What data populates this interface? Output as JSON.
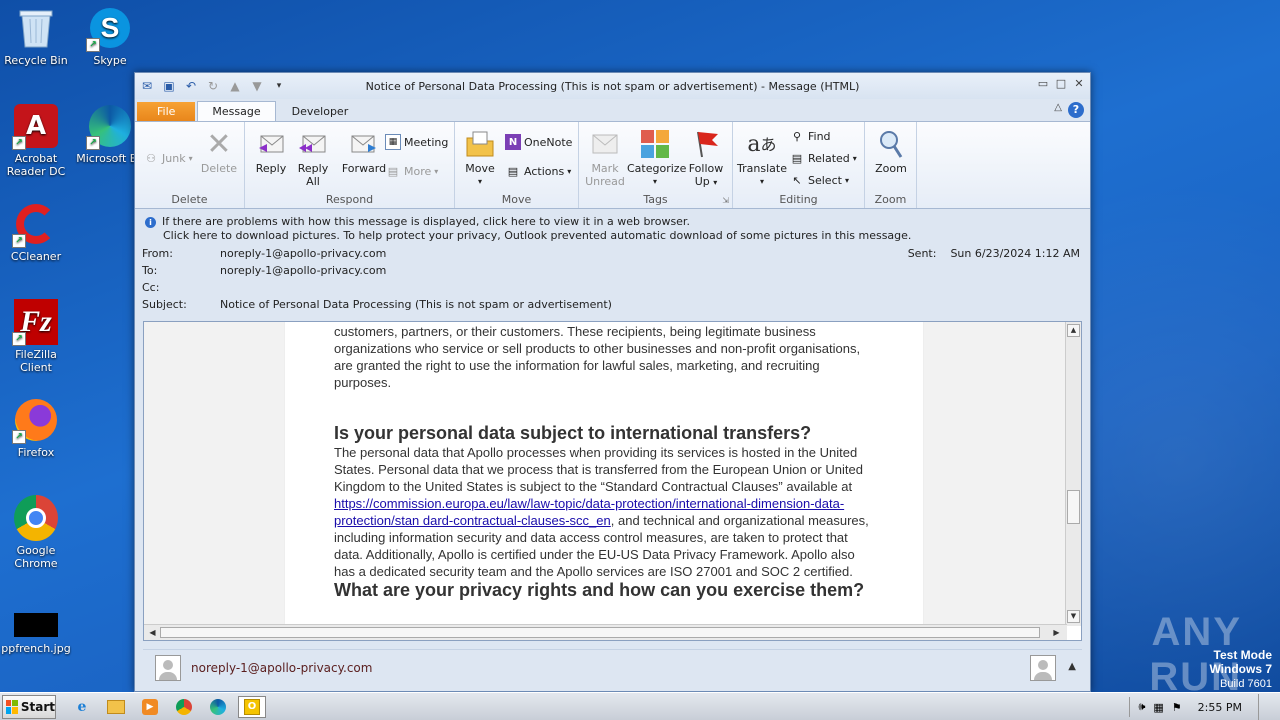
{
  "desktop": {
    "icons": [
      {
        "label": "Recycle Bin",
        "icon": "recycle-bin-icon"
      },
      {
        "label": "Skype",
        "icon": "skype-icon"
      },
      {
        "label": "Acrobat Reader DC",
        "icon": "acrobat-icon"
      },
      {
        "label": "Microsoft Edge",
        "icon": "edge-icon"
      },
      {
        "label": "CCleaner",
        "icon": "ccleaner-icon"
      },
      {
        "label": "FileZilla Client",
        "icon": "filezilla-icon"
      },
      {
        "label": "Firefox",
        "icon": "firefox-icon"
      },
      {
        "label": "Google Chrome",
        "icon": "chrome-icon"
      },
      {
        "label": "ppfrench.jpg",
        "icon": "image-file-icon"
      }
    ],
    "edge_label_visible": "Microsoft Ed",
    "watermark": {
      "brand": "ANY RUN",
      "mode_line1": "Test Mode",
      "mode_line2": "Windows 7",
      "build": "Build 7601"
    }
  },
  "window": {
    "title": "Notice of Personal Data Processing (This is not spam or advertisement)  -  Message (HTML)",
    "tabs": [
      "File",
      "Message",
      "Developer"
    ],
    "active_tab": "Message",
    "ribbon": {
      "delete": {
        "label": "Delete",
        "junk": "Junk",
        "delete_btn": "Delete"
      },
      "respond": {
        "label": "Respond",
        "reply": "Reply",
        "reply_all_1": "Reply",
        "reply_all_2": "All",
        "forward": "Forward",
        "meeting": "Meeting",
        "more": "More"
      },
      "move": {
        "label": "Move",
        "move_btn": "Move",
        "onenote": "OneNote",
        "actions": "Actions"
      },
      "tags": {
        "label": "Tags",
        "mark_unread_1": "Mark",
        "mark_unread_2": "Unread",
        "categorize": "Categorize",
        "follow_up_1": "Follow",
        "follow_up_2": "Up"
      },
      "editing": {
        "label": "Editing",
        "translate": "Translate",
        "find": "Find",
        "related": "Related",
        "select": "Select"
      },
      "zoom": {
        "label": "Zoom",
        "zoom_btn": "Zoom"
      }
    },
    "infobar": {
      "line1": "If there are problems with how this message is displayed, click here to view it in a web browser.",
      "line2": "Click here to download pictures. To help protect your privacy, Outlook prevented automatic download of some pictures in this message."
    },
    "header": {
      "from_label": "From:",
      "from": "noreply-1@apollo-privacy.com",
      "to_label": "To:",
      "to": "noreply-1@apollo-privacy.com",
      "cc_label": "Cc:",
      "cc": "",
      "subject_label": "Subject:",
      "subject": "Notice of Personal Data Processing (This is not spam or advertisement)",
      "sent_label": "Sent:",
      "sent": "Sun 6/23/2024 1:12 AM"
    },
    "body": {
      "para1": "customers, partners, or their customers. These recipients, being legitimate business organizations who service or sell products to other businesses and non-profit organisations, are granted the right to use the information for lawful sales, marketing, and recruiting purposes.",
      "heading1": "Is your personal data subject to international transfers?",
      "para2_pre": "The personal data that Apollo processes when providing its services is hosted in the United States. Personal data that we process that is transferred from the European Union or United Kingdom to the United States is subject to the “Standard Contractual Clauses” available at ",
      "para2_link": "https://commission.europa.eu/law/law-topic/data-protection/international-dimension-data-protection/stan dard-contractual-clauses-scc_en",
      "para2_post": ", and technical and organizational measures, including information security and data access control measures, are taken to protect that data. Additionally, Apollo is certified under the EU-US Data Privacy Framework. Apollo also has a dedicated security team and the Apollo services are ISO 27001 and SOC 2 certified.",
      "heading2": "What are your privacy rights and how can you exercise them?"
    },
    "people_pane": {
      "name": "noreply-1@apollo-privacy.com"
    }
  },
  "taskbar": {
    "start": "Start",
    "apps": [
      "ie-icon",
      "explorer-icon",
      "media-player-icon",
      "chrome-icon",
      "edge-icon",
      "outlook-icon"
    ],
    "clock": "2:55 PM"
  }
}
